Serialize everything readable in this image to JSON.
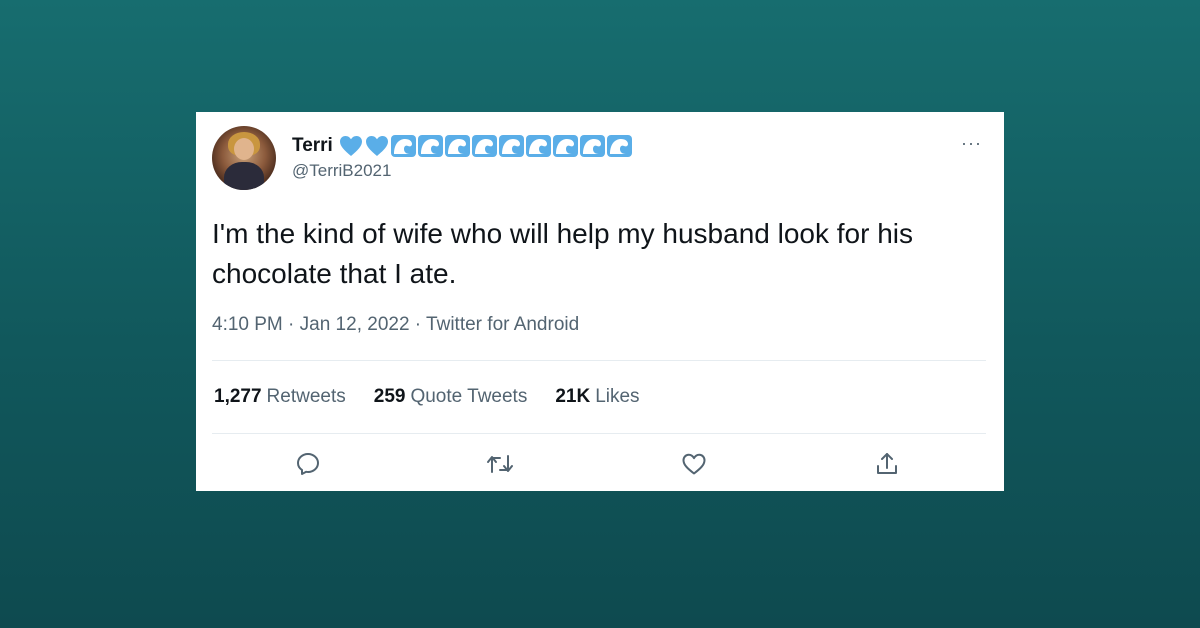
{
  "tweet": {
    "author": {
      "display_name": "Terri",
      "handle": "@TerriB2021",
      "name_emoji": [
        "blue-heart",
        "blue-heart",
        "wave",
        "wave",
        "wave",
        "wave",
        "wave",
        "wave",
        "wave",
        "wave",
        "wave"
      ]
    },
    "text": "I'm the kind of wife who will help my husband look for his chocolate that I ate.",
    "meta": "4:10 PM · Jan 12, 2022 · Twitter for Android",
    "more_label": "···",
    "stats": {
      "retweets_count": "1,277",
      "retweets_label": "Retweets",
      "quotes_count": "259",
      "quotes_label": "Quote Tweets",
      "likes_count": "21K",
      "likes_label": "Likes"
    },
    "actions": [
      "reply-icon",
      "retweet-icon",
      "like-icon",
      "share-icon"
    ]
  },
  "colors": {
    "background_top": "#176d6f",
    "background_bottom": "#0e4a4f",
    "text_primary": "#0f1419",
    "text_secondary": "#536471",
    "emoji_blue": "#5aaee8"
  }
}
